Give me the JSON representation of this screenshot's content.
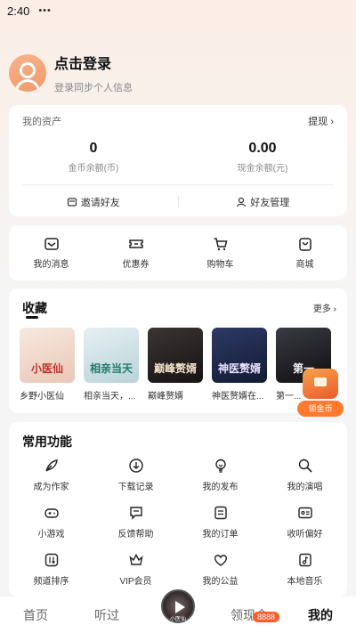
{
  "status_bar": {
    "time": "2:40",
    "dots": "•••"
  },
  "profile": {
    "title": "点击登录",
    "subtitle": "登录同步个人信息"
  },
  "assets": {
    "heading": "我的资产",
    "withdraw": "提现",
    "coin_value": "0",
    "coin_label": "金币余额(币)",
    "cash_value": "0.00",
    "cash_label": "现金余额(元)",
    "invite": "邀请好友",
    "friends": "好友管理"
  },
  "quick": [
    {
      "label": "我的消息",
      "icon": "message-icon"
    },
    {
      "label": "优惠券",
      "icon": "coupon-icon"
    },
    {
      "label": "购物车",
      "icon": "cart-icon"
    },
    {
      "label": "商城",
      "icon": "shop-bag-icon"
    }
  ],
  "collection": {
    "title": "收藏",
    "more": "更多",
    "books": [
      {
        "name": "乡野小医仙",
        "cover_text": "小医仙"
      },
      {
        "name": "相亲当天，...",
        "cover_text": "相亲当天"
      },
      {
        "name": "巅峰赘婿",
        "cover_text": "巅峰赘婿"
      },
      {
        "name": "神医赘婿在...",
        "cover_text": "神医赘婿"
      },
      {
        "name": "第一...",
        "cover_text": "第一"
      }
    ]
  },
  "float_coin": {
    "label": "领金币"
  },
  "functions": {
    "title": "常用功能",
    "items": [
      {
        "label": "成为作家",
        "icon": "quill-icon"
      },
      {
        "label": "下载记录",
        "icon": "download-icon"
      },
      {
        "label": "我的发布",
        "icon": "lightbulb-icon"
      },
      {
        "label": "我的演唱",
        "icon": "search-mic-icon"
      },
      {
        "label": "小游戏",
        "icon": "gamepad-icon"
      },
      {
        "label": "反馈帮助",
        "icon": "feedback-icon"
      },
      {
        "label": "我的订单",
        "icon": "order-icon"
      },
      {
        "label": "收听偏好",
        "icon": "preference-icon"
      },
      {
        "label": "频道排序",
        "icon": "sort-icon"
      },
      {
        "label": "VIP会员",
        "icon": "crown-icon"
      },
      {
        "label": "我的公益",
        "icon": "charity-icon"
      },
      {
        "label": "本地音乐",
        "icon": "music-file-icon"
      }
    ]
  },
  "tabbar": {
    "home": "首页",
    "listened": "听过",
    "disc_text": "小医仙",
    "cash": "领现金",
    "cash_badge": "8888",
    "mine": "我的"
  }
}
